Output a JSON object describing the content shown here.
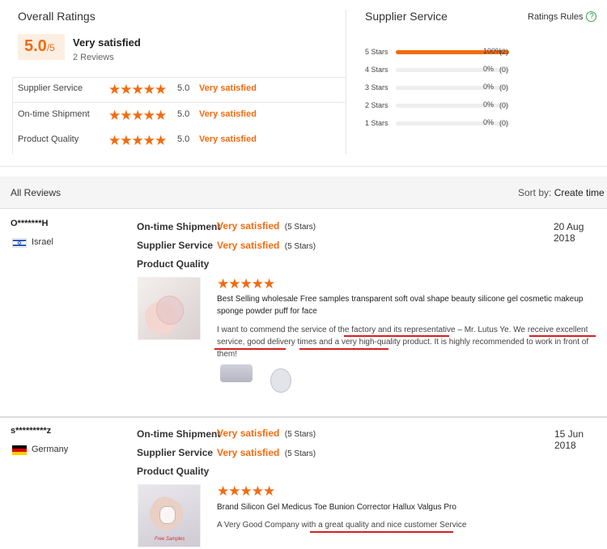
{
  "overall": {
    "title": "Overall Ratings",
    "score": "5.0",
    "score_suffix": "/5",
    "verdict": "Very satisfied",
    "reviews_count": "2 Reviews",
    "rows": [
      {
        "label": "Supplier Service",
        "score": "5.0",
        "verdict": "Very satisfied",
        "stars": 5
      },
      {
        "label": "On-time Shipment",
        "score": "5.0",
        "verdict": "Very satisfied",
        "stars": 5
      },
      {
        "label": "Product Quality",
        "score": "5.0",
        "verdict": "Very satisfied",
        "stars": 5
      }
    ]
  },
  "supplier": {
    "title": "Supplier Service",
    "rules_label": "Ratings Rules",
    "rules_icon": "question-circle-icon",
    "bars": [
      {
        "label": "5 Stars",
        "percent_text": "100%",
        "count": "(2)",
        "fraction": 1.0
      },
      {
        "label": "4 Stars",
        "percent_text": "0%",
        "count": "(0)",
        "fraction": 0
      },
      {
        "label": "3 Stars",
        "percent_text": "0%",
        "count": "(0)",
        "fraction": 0
      },
      {
        "label": "2 Stars",
        "percent_text": "0%",
        "count": "(0)",
        "fraction": 0
      },
      {
        "label": "1 Stars",
        "percent_text": "0%",
        "count": "(0)",
        "fraction": 0
      }
    ]
  },
  "all_reviews": {
    "title": "All Reviews",
    "sort_prefix": "Sort by:",
    "sort_value": "Create time"
  },
  "reviews": [
    {
      "user": "O*******H",
      "country": "Israel",
      "date": "20 Aug 2018",
      "shipment_label": "On-time Shipment",
      "shipment_value": "Very satisfied",
      "shipment_stars": "(5 Stars)",
      "service_label": "Supplier Service",
      "service_value": "Very satisfied",
      "service_stars": "(5 Stars)",
      "quality_label": "Product Quality",
      "product_stars": 5,
      "product_name": "Best Selling wholesale Free samples transparent soft oval shape beauty silicone gel cosmetic makeup sponge powder puff for face",
      "comment": "I want to commend the service of the factory and its representative – Mr. Lutus Ye. We receive excellent service, good delivery times and a very high-quality product. It is highly recommended to work in front of them!"
    },
    {
      "user": "s*********z",
      "country": "Germany",
      "date": "15 Jun 2018",
      "shipment_label": "On-time Shipment",
      "shipment_value": "Very satisfied",
      "shipment_stars": "(5 Stars)",
      "service_label": "Supplier Service",
      "service_value": "Very satisfied",
      "service_stars": "(5 Stars)",
      "quality_label": "Product Quality",
      "product_stars": 5,
      "product_name": "Brand Silicon Gel Medicus Toe Bunion Corrector Hallux Valgus Pro",
      "comment": "A Very Good Company with a great quality and nice customer Service",
      "image_caption": "Free Samples"
    }
  ],
  "colors": {
    "accent": "#f26b0f",
    "underline": "#d61f1f",
    "help": "#3aa34a"
  }
}
